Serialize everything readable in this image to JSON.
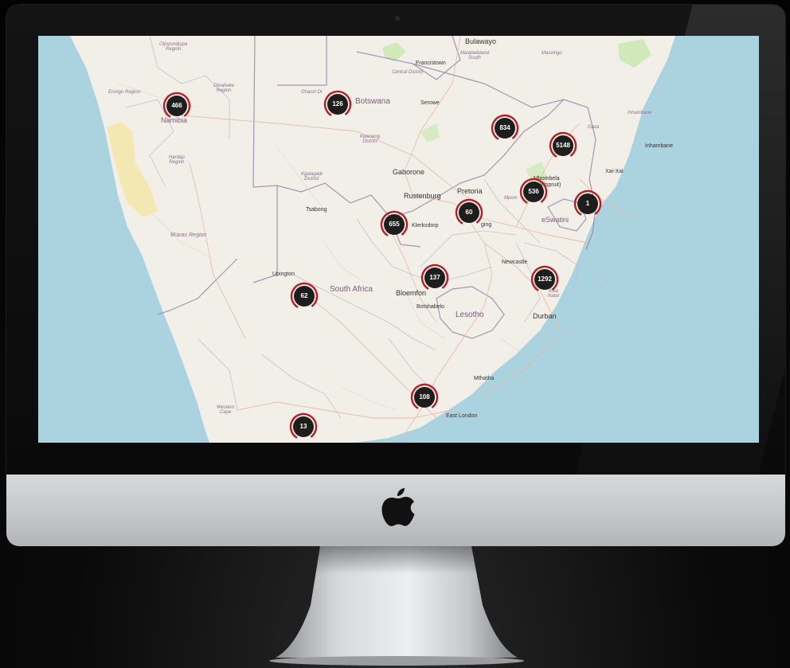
{
  "map": {
    "countries": [
      {
        "id": "botswana",
        "label": "Botswana"
      },
      {
        "id": "south-africa",
        "label": "South Africa"
      },
      {
        "id": "lesotho",
        "label": "Lesotho"
      },
      {
        "id": "eswatini",
        "label": "eSwatini"
      },
      {
        "id": "namibia",
        "label": "Namibia"
      }
    ],
    "cities": [
      {
        "id": "bulawayo",
        "label": "Bulawayo"
      },
      {
        "id": "francistown",
        "label": "Francistown"
      },
      {
        "id": "serowe",
        "label": "Serowe"
      },
      {
        "id": "gaborone",
        "label": "Gaborone"
      },
      {
        "id": "rustenburg",
        "label": "Rustenburg"
      },
      {
        "id": "pretoria",
        "label": "Pretoria"
      },
      {
        "id": "tsabong",
        "label": "Tsabong"
      },
      {
        "id": "klerksdorp",
        "label": "Klerksdorp"
      },
      {
        "id": "vereeniging",
        "label": "ging"
      },
      {
        "id": "upington",
        "label": "Upington"
      },
      {
        "id": "bloemfontein",
        "label": "Bloemfon"
      },
      {
        "id": "botshabelo",
        "label": "Botshabelo"
      },
      {
        "id": "newcastle",
        "label": "Newcastle"
      },
      {
        "id": "durban",
        "label": "Durban"
      },
      {
        "id": "mthatha",
        "label": "Mthatha"
      },
      {
        "id": "east-london",
        "label": "East London"
      },
      {
        "id": "inhambane",
        "label": "Inhambane"
      },
      {
        "id": "xai-xai",
        "label": "Xai-Xai"
      },
      {
        "id": "mbombela",
        "label": "Mbombela"
      },
      {
        "id": "nelspruit",
        "label": "(Nelspruit)"
      }
    ],
    "regions": [
      {
        "id": "otjozondjupa",
        "label": "Otjozondjupa\nRegion"
      },
      {
        "id": "omaheke",
        "label": "Omaheke\nRegion"
      },
      {
        "id": "erongo",
        "label": "Erongo Region"
      },
      {
        "id": "hardap",
        "label": "Hardap\nRegion"
      },
      {
        "id": "karas",
        "label": "ǁKaras Region"
      },
      {
        "id": "ghanzi",
        "label": "Ghanzi Di"
      },
      {
        "id": "kweneng",
        "label": "Kweneng\nDistrict"
      },
      {
        "id": "kgalagadi",
        "label": "Kgalagadi\nDistrict"
      },
      {
        "id": "central-district",
        "label": "Central District"
      },
      {
        "id": "matabeleland",
        "label": "Matabeleland\nSouth"
      },
      {
        "id": "masvingo",
        "label": "Masvingo"
      },
      {
        "id": "gaza",
        "label": "Gaza"
      },
      {
        "id": "inhambane-prov",
        "label": "Inhambane"
      },
      {
        "id": "western-cape",
        "label": "Western\nCape"
      },
      {
        "id": "mpumalanga",
        "label": "Mpum"
      },
      {
        "id": "kzn",
        "label": "Kwa\nNatal"
      }
    ],
    "markers": [
      {
        "id": "windhoek",
        "count": "466"
      },
      {
        "id": "ghanzi",
        "count": "126"
      },
      {
        "id": "polokwane",
        "count": "834"
      },
      {
        "id": "mozambique",
        "count": "5148"
      },
      {
        "id": "mbombela",
        "count": "536"
      },
      {
        "id": "maputo",
        "count": "1"
      },
      {
        "id": "johannesburg",
        "count": "60"
      },
      {
        "id": "klerksdorp",
        "count": "655"
      },
      {
        "id": "bloemfontein",
        "count": "137"
      },
      {
        "id": "kzn",
        "count": "1292"
      },
      {
        "id": "upington",
        "count": "62"
      },
      {
        "id": "eastern-cape",
        "count": "108"
      },
      {
        "id": "cape-town",
        "count": "13"
      }
    ]
  },
  "colors": {
    "ocean": "#aad3df",
    "land": "#f2efe9",
    "desert": "#f5e6a8",
    "marker_fill": "#1e1e1e",
    "marker_ring": "#b51d25",
    "border": "#9e8aa8"
  }
}
